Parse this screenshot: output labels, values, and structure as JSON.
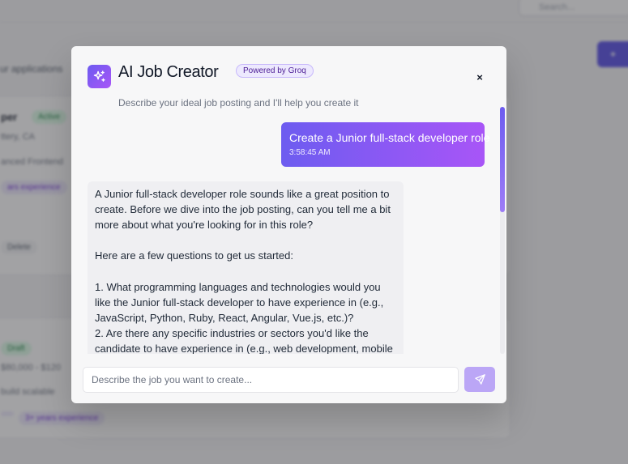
{
  "background": {
    "search_placeholder": "Search...",
    "subtitle": "ur applications",
    "create_button": "+",
    "card1": {
      "title": "per",
      "status": "Active",
      "meta_line": "ttery, CA",
      "description_line": "anced Frontend",
      "tag": "ars experience",
      "button": "Delete"
    },
    "card2": {
      "status": "Draft",
      "meta_line": "$80,000 - $120",
      "description_line": "build scalable",
      "tags": [
        "",
        "3+ years experience"
      ]
    }
  },
  "modal": {
    "title": "AI Job Creator",
    "badge": "Powered by Groq",
    "subtitle": "Describe your ideal job posting and I'll help you create it",
    "close_label": "×",
    "messages": {
      "user": {
        "text": "Create a Junior full-stack developer role",
        "time": "3:58:45 AM"
      },
      "assistant": {
        "text": "A Junior full-stack developer role sounds like a great position to create. Before we dive into the job posting, can you tell me a bit more about what you're looking for in this role?\n\nHere are a few questions to get us started:\n\n1. What programming languages and technologies would you like the Junior full-stack developer to have experience in (e.g., JavaScript, Python, Ruby, React, Angular, Vue.js, etc.)?\n2. Are there any specific industries or sectors you'd like the candidate to have experience in (e.g., web development, mobile"
      }
    },
    "input": {
      "placeholder": "Describe the job you want to create...",
      "value": ""
    },
    "send_icon": "send-icon"
  },
  "colors": {
    "accent_start": "#6d5cf0",
    "accent_end": "#a855f7",
    "send_button": "#bba6f6"
  }
}
